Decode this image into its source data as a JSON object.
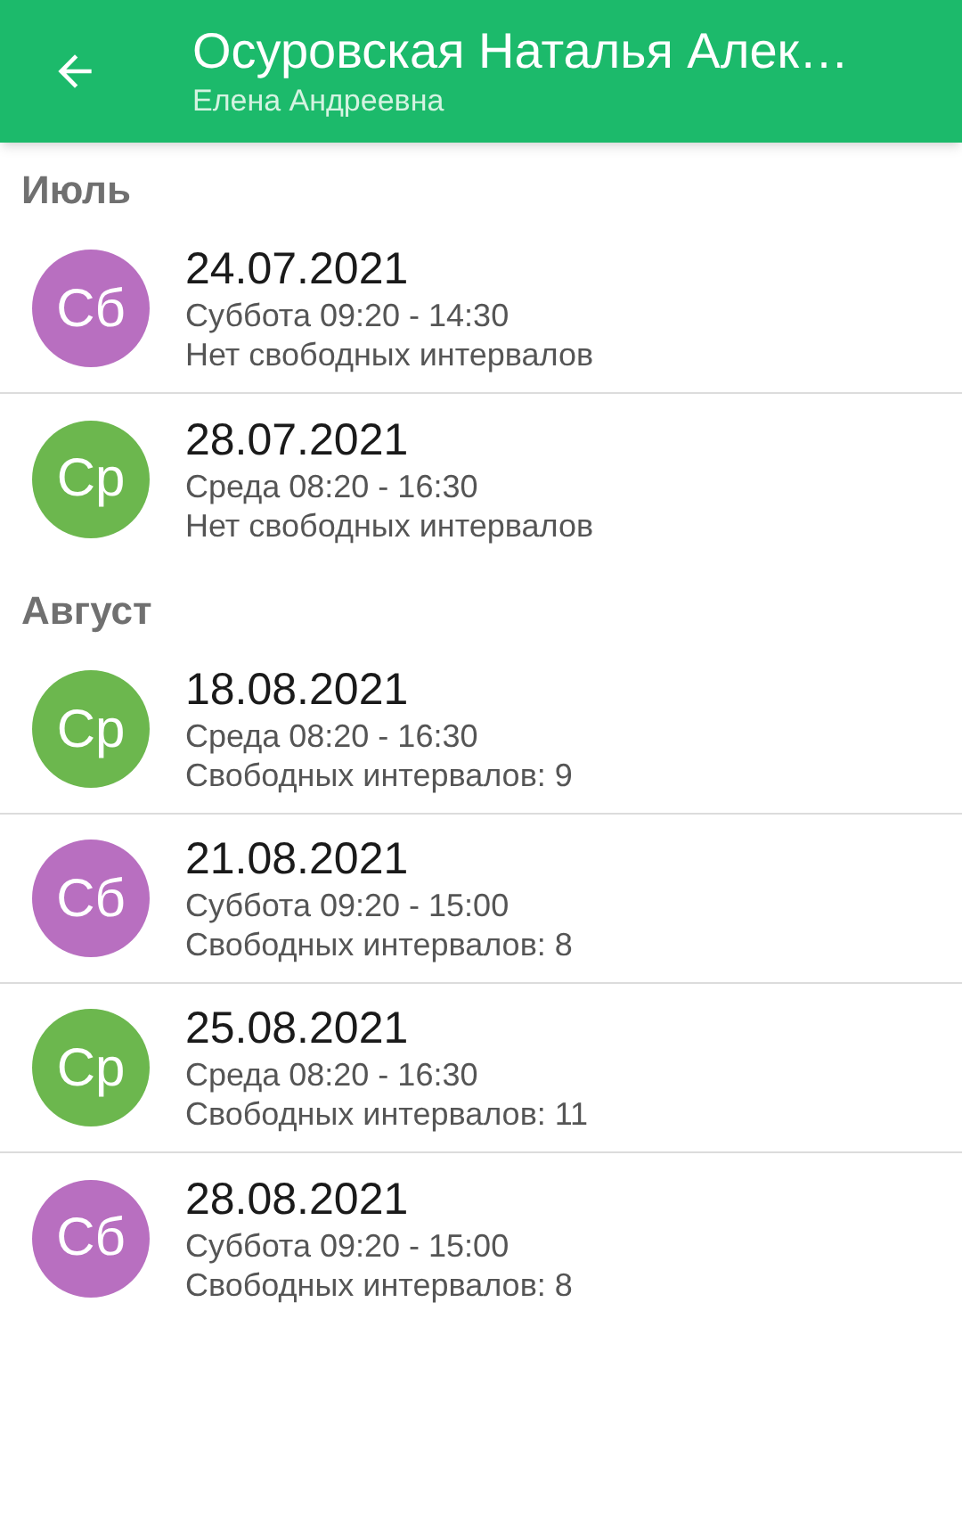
{
  "app_bar": {
    "title": "Осуровская Наталья Алек…",
    "subtitle": "Елена Андреевна"
  },
  "sections": [
    {
      "heading": "Июль",
      "items": [
        {
          "badge": "Сб",
          "color": "#b86fc0",
          "date": "24.07.2021",
          "schedule": "Суббота 09:20 - 14:30",
          "intervals": "Нет свободных интервалов"
        },
        {
          "badge": "Ср",
          "color": "#6cb74e",
          "date": "28.07.2021",
          "schedule": "Среда 08:20 - 16:30",
          "intervals": "Нет свободных интервалов"
        }
      ]
    },
    {
      "heading": "Август",
      "items": [
        {
          "badge": "Ср",
          "color": "#6cb74e",
          "date": "18.08.2021",
          "schedule": "Среда 08:20 - 16:30",
          "intervals": "Свободных интервалов: 9"
        },
        {
          "badge": "Сб",
          "color": "#b86fc0",
          "date": "21.08.2021",
          "schedule": "Суббота 09:20 - 15:00",
          "intervals": "Свободных интервалов: 8"
        },
        {
          "badge": "Ср",
          "color": "#6cb74e",
          "date": "25.08.2021",
          "schedule": "Среда 08:20 - 16:30",
          "intervals": "Свободных интервалов: 11"
        },
        {
          "badge": "Сб",
          "color": "#b86fc0",
          "date": "28.08.2021",
          "schedule": "Суббота 09:20 - 15:00",
          "intervals": "Свободных интервалов: 8"
        }
      ]
    }
  ]
}
